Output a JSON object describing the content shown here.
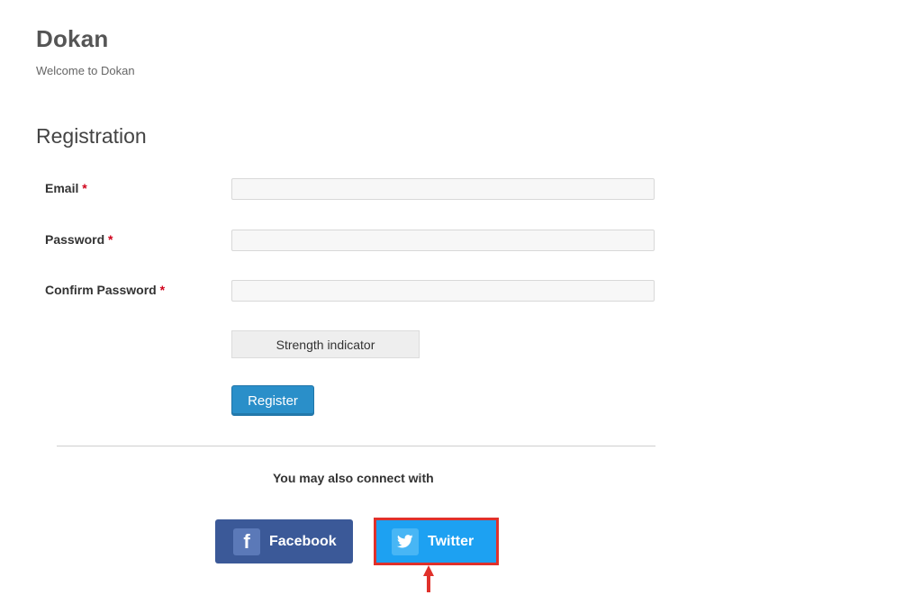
{
  "site": {
    "title": "Dokan",
    "description": "Welcome to Dokan"
  },
  "registration": {
    "title": "Registration",
    "required_marker": "*",
    "fields": {
      "email": {
        "label": "Email",
        "value": ""
      },
      "password": {
        "label": "Password",
        "value": ""
      },
      "confirm_password": {
        "label": "Confirm Password",
        "value": ""
      }
    },
    "strength_indicator": "Strength indicator",
    "register_label": "Register"
  },
  "social": {
    "connect_text": "You may also connect with",
    "facebook_label": "Facebook",
    "twitter_label": "Twitter",
    "facebook_icon": "facebook-icon",
    "twitter_icon": "twitter-bird-icon"
  },
  "colors": {
    "facebook": "#3b5998",
    "twitter": "#1da1f2",
    "register": "#2a8fc9",
    "highlight": "#e0312b",
    "required": "#d0021b"
  }
}
